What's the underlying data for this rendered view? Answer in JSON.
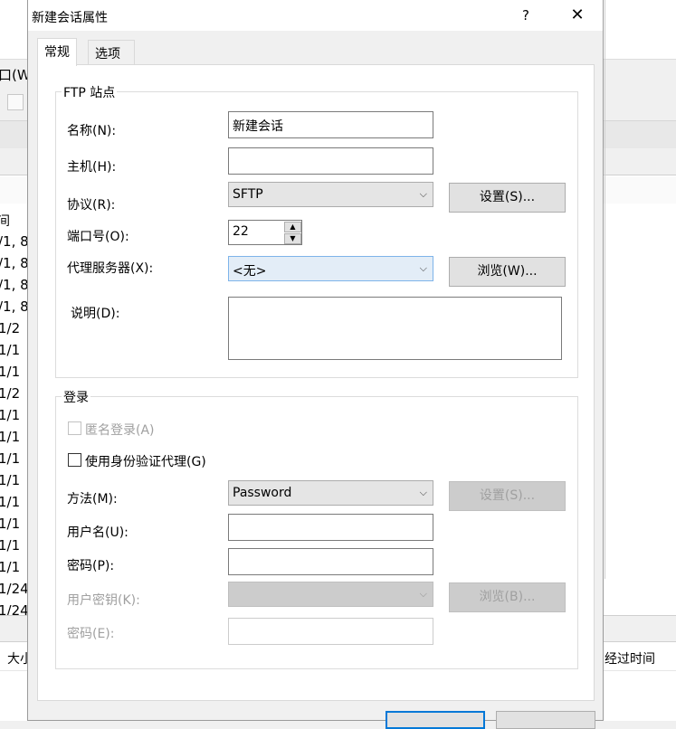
{
  "background": {
    "menu_label": "口(W)",
    "list_header": "间",
    "rows": [
      "/1, 8",
      "/1, 8",
      "/1, 8",
      "/1, 8",
      "1/2",
      "1/1",
      "1/1",
      "1/2",
      "1/1",
      "1/1",
      "1/1",
      "1/1",
      "1/1",
      "1/1",
      "1/1",
      "1/1",
      "1/24",
      "1/24"
    ],
    "bottom_col_size": "大小",
    "bottom_col_elapsed": "经过时间"
  },
  "dialog": {
    "title": "新建会话属性",
    "help": "?",
    "close": "✕",
    "tabs": [
      {
        "label": "常规",
        "active": true
      },
      {
        "label": "选项",
        "active": false
      }
    ],
    "ftp_group": {
      "legend": "FTP 站点",
      "name_label": "名称(N):",
      "name_value": "新建会话",
      "host_label": "主机(H):",
      "host_value": "",
      "protocol_label": "协议(R):",
      "protocol_value": "SFTP",
      "settings_button": "设置(S)...",
      "port_label": "端口号(O):",
      "port_value": "22",
      "proxy_label": "代理服务器(X):",
      "proxy_value": "<无>",
      "browse_button": "浏览(W)...",
      "desc_label": "说明(D):",
      "desc_value": ""
    },
    "login_group": {
      "legend": "登录",
      "anonymous_label": "匿名登录(A)",
      "anonymous_checked": false,
      "auth_agent_label": "使用身份验证代理(G)",
      "auth_agent_checked": false,
      "method_label": "方法(M):",
      "method_value": "Password",
      "method_settings_button": "设置(S)...",
      "username_label": "用户名(U):",
      "username_value": "",
      "password_label": "密码(P):",
      "password_value": "",
      "userkey_label": "用户密钥(K):",
      "userkey_value": "",
      "userkey_browse_button": "浏览(B)...",
      "passphrase_label": "密码(E):",
      "passphrase_value": ""
    }
  },
  "colors": {
    "focus_border": "#7eb4ea",
    "primary_button_border": "#0078d7",
    "disabled_text": "#a0a0a0"
  }
}
